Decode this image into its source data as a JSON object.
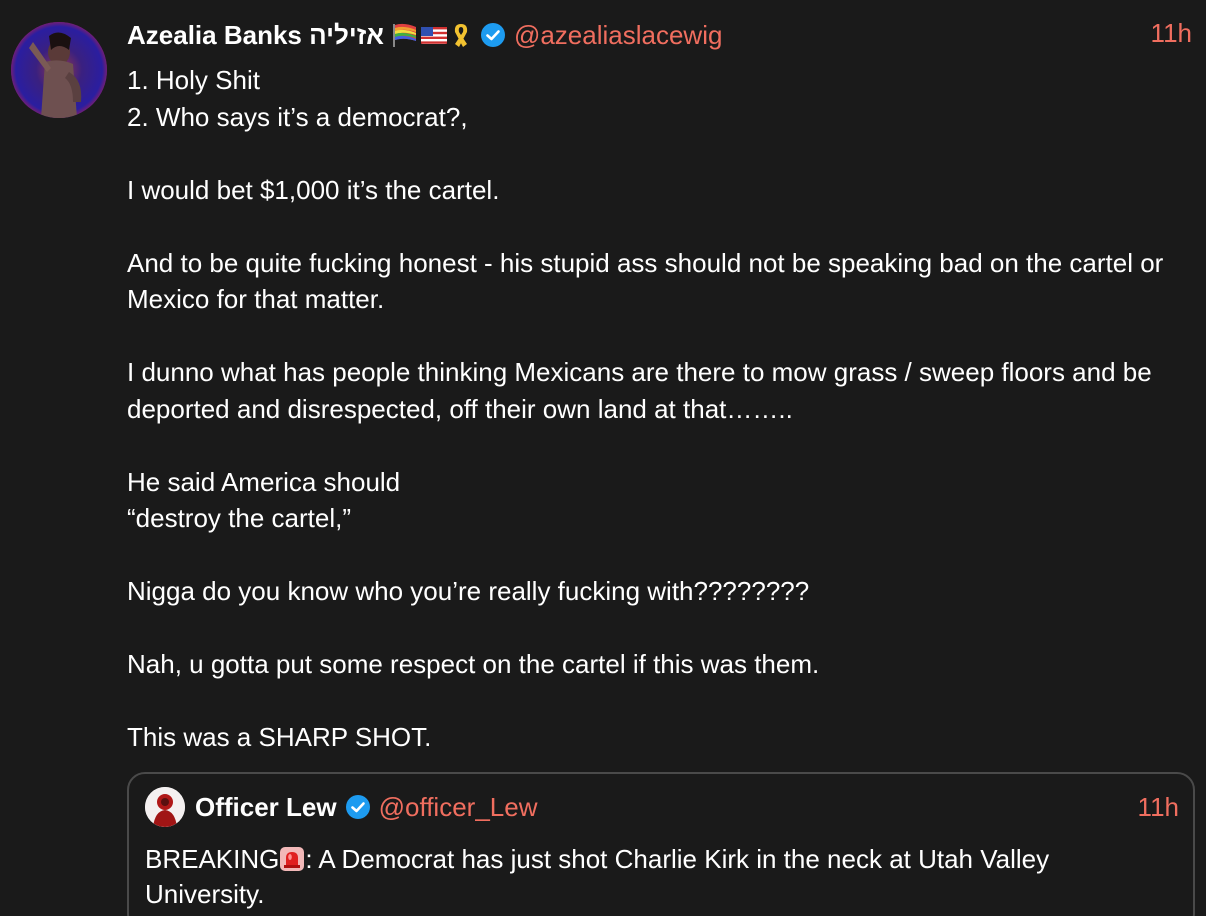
{
  "tweet": {
    "author": {
      "display_name": "Azealia Banks אזיליה",
      "handle": "@azealiaslacewig",
      "verified": true,
      "name_emojis": [
        "rainbow-flag-icon",
        "us-flag-icon",
        "yellow-ribbon-icon"
      ]
    },
    "timestamp": "11h",
    "lines": [
      "1. Holy Shit",
      "2. Who says it’s a democrat?,",
      "",
      "I would bet $1,000 it’s the cartel.",
      "",
      "And to be quite fucking honest - his stupid ass should not be speaking bad on the cartel or Mexico for that matter.",
      "",
      "I dunno what has people thinking Mexicans are there to mow grass / sweep floors and be deported and disrespected, off their own land at that……..",
      "",
      "He said America should",
      "“destroy the cartel,”",
      "",
      "Nigga do you know who you’re really fucking with????????",
      "",
      "Nah, u gotta put some respect on the cartel if this was them.",
      "",
      "This was a SHARP SHOT."
    ]
  },
  "quoted_tweet": {
    "author": {
      "display_name": "Officer Lew",
      "handle": "@officer_Lew",
      "verified": true
    },
    "timestamp": "11h",
    "text_prefix": "BREAKING",
    "text_emoji": "siren-icon",
    "text_suffix": ": A Democrat has just shot Charlie Kirk in the neck at Utah Valley University."
  },
  "colors": {
    "background": "#1a1a1a",
    "accent": "#f06e5f",
    "verified": "#1d9bf0",
    "border": "#4a4a4a",
    "text": "#ffffff"
  }
}
